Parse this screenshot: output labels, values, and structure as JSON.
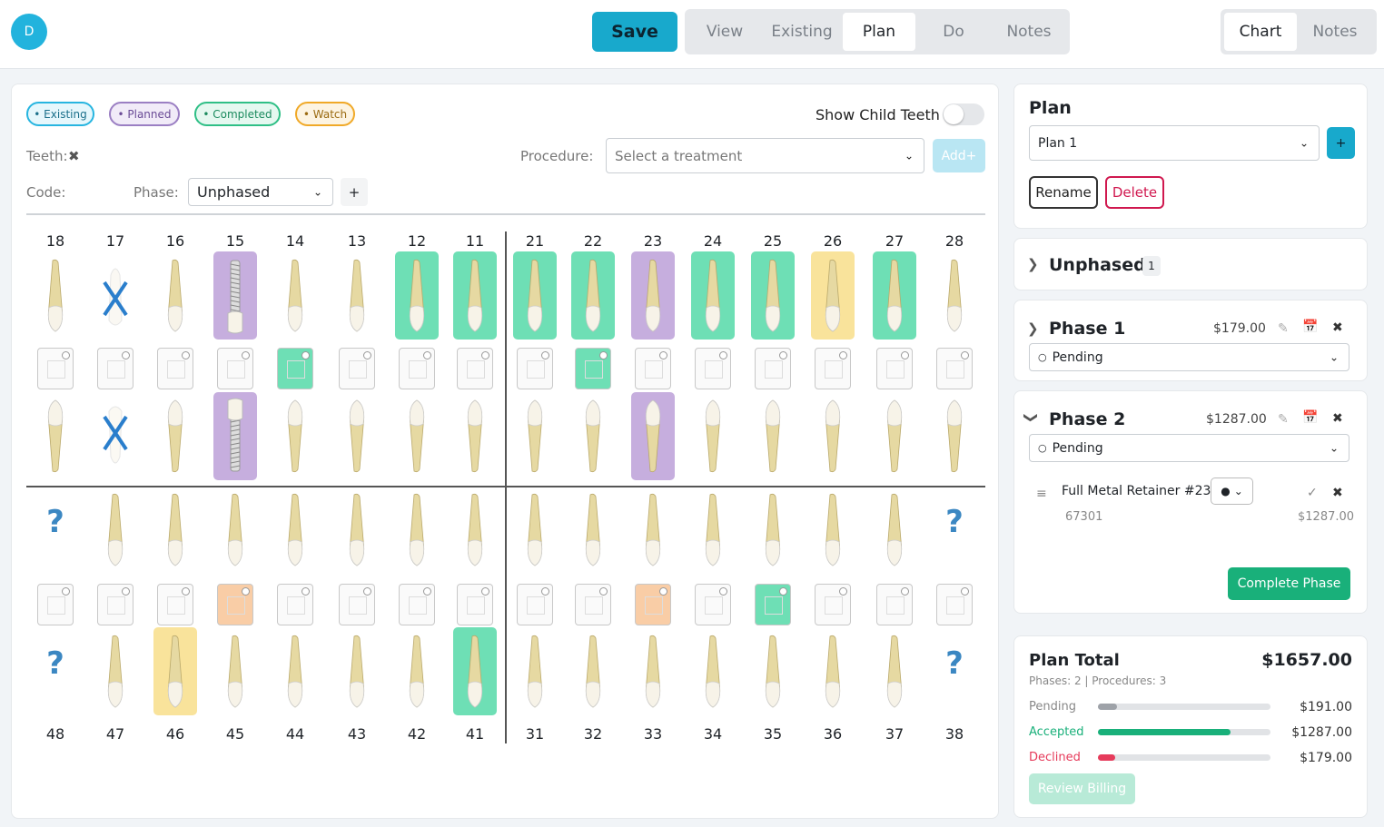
{
  "user": {
    "initial": "D"
  },
  "toolbar": {
    "save_label": "Save",
    "mode_tabs": [
      "View",
      "Existing",
      "Plan",
      "Do",
      "Notes"
    ],
    "active_mode": "Plan",
    "view_tabs": [
      "Chart",
      "Notes"
    ],
    "active_view": "Chart"
  },
  "legend": [
    {
      "label": "• Existing",
      "color": "#27b5e0"
    },
    {
      "label": "• Planned",
      "color": "#9b7fc3"
    },
    {
      "label": "• Completed",
      "color": "#2fbf86"
    },
    {
      "label": "• Watch",
      "color": "#f0a928"
    }
  ],
  "controls": {
    "show_child_teeth_label": "Show Child Teeth",
    "teeth_label": "Teeth:",
    "teeth_clear_icon": "✖",
    "procedure_label": "Procedure:",
    "procedure_placeholder": "Select a treatment",
    "add_label": "Add+",
    "code_label": "Code:",
    "phase_label": "Phase:",
    "phase_value": "Unphased",
    "phase_add": "+"
  },
  "upper_teeth": [
    "18",
    "17",
    "16",
    "15",
    "14",
    "13",
    "12",
    "11",
    "21",
    "22",
    "23",
    "24",
    "25",
    "26",
    "27",
    "28"
  ],
  "lower_teeth": [
    "48",
    "47",
    "46",
    "45",
    "44",
    "43",
    "42",
    "41",
    "31",
    "32",
    "33",
    "34",
    "35",
    "36",
    "37",
    "38"
  ],
  "colors": {
    "planned": "#c6aede",
    "completed": "#6edfb5",
    "watch": "#f9e39b",
    "accent": "#18a9cc",
    "delete": "#d0184f",
    "orange": "#f9cda6"
  },
  "plan": {
    "title": "Plan",
    "selected": "Plan 1",
    "add_icon": "+",
    "rename_label": "Rename",
    "delete_label": "Delete"
  },
  "unphased": {
    "label": "Unphased",
    "count": "1"
  },
  "phase1": {
    "label": "Phase 1",
    "amount": "$179.00",
    "status": "Pending"
  },
  "phase2": {
    "label": "Phase 2",
    "amount": "$1287.00",
    "status": "Pending",
    "procedure": {
      "name": "Full Metal Retainer #23",
      "code": "67301",
      "amount": "$1287.00"
    },
    "complete_label": "Complete Phase"
  },
  "totals": {
    "title": "Plan Total",
    "amount": "$1657.00",
    "summary": "Phases: 2 | Procedures: 3",
    "rows": [
      {
        "label": "Pending",
        "amount": "$191.00",
        "fraction": 0.11,
        "color": "#9ea2a8"
      },
      {
        "label": "Accepted",
        "amount": "$1287.00",
        "fraction": 0.77,
        "color": "#19b07a"
      },
      {
        "label": "Declined",
        "amount": "$179.00",
        "fraction": 0.1,
        "color": "#e63b5b"
      }
    ],
    "review_label": "Review Billing"
  }
}
